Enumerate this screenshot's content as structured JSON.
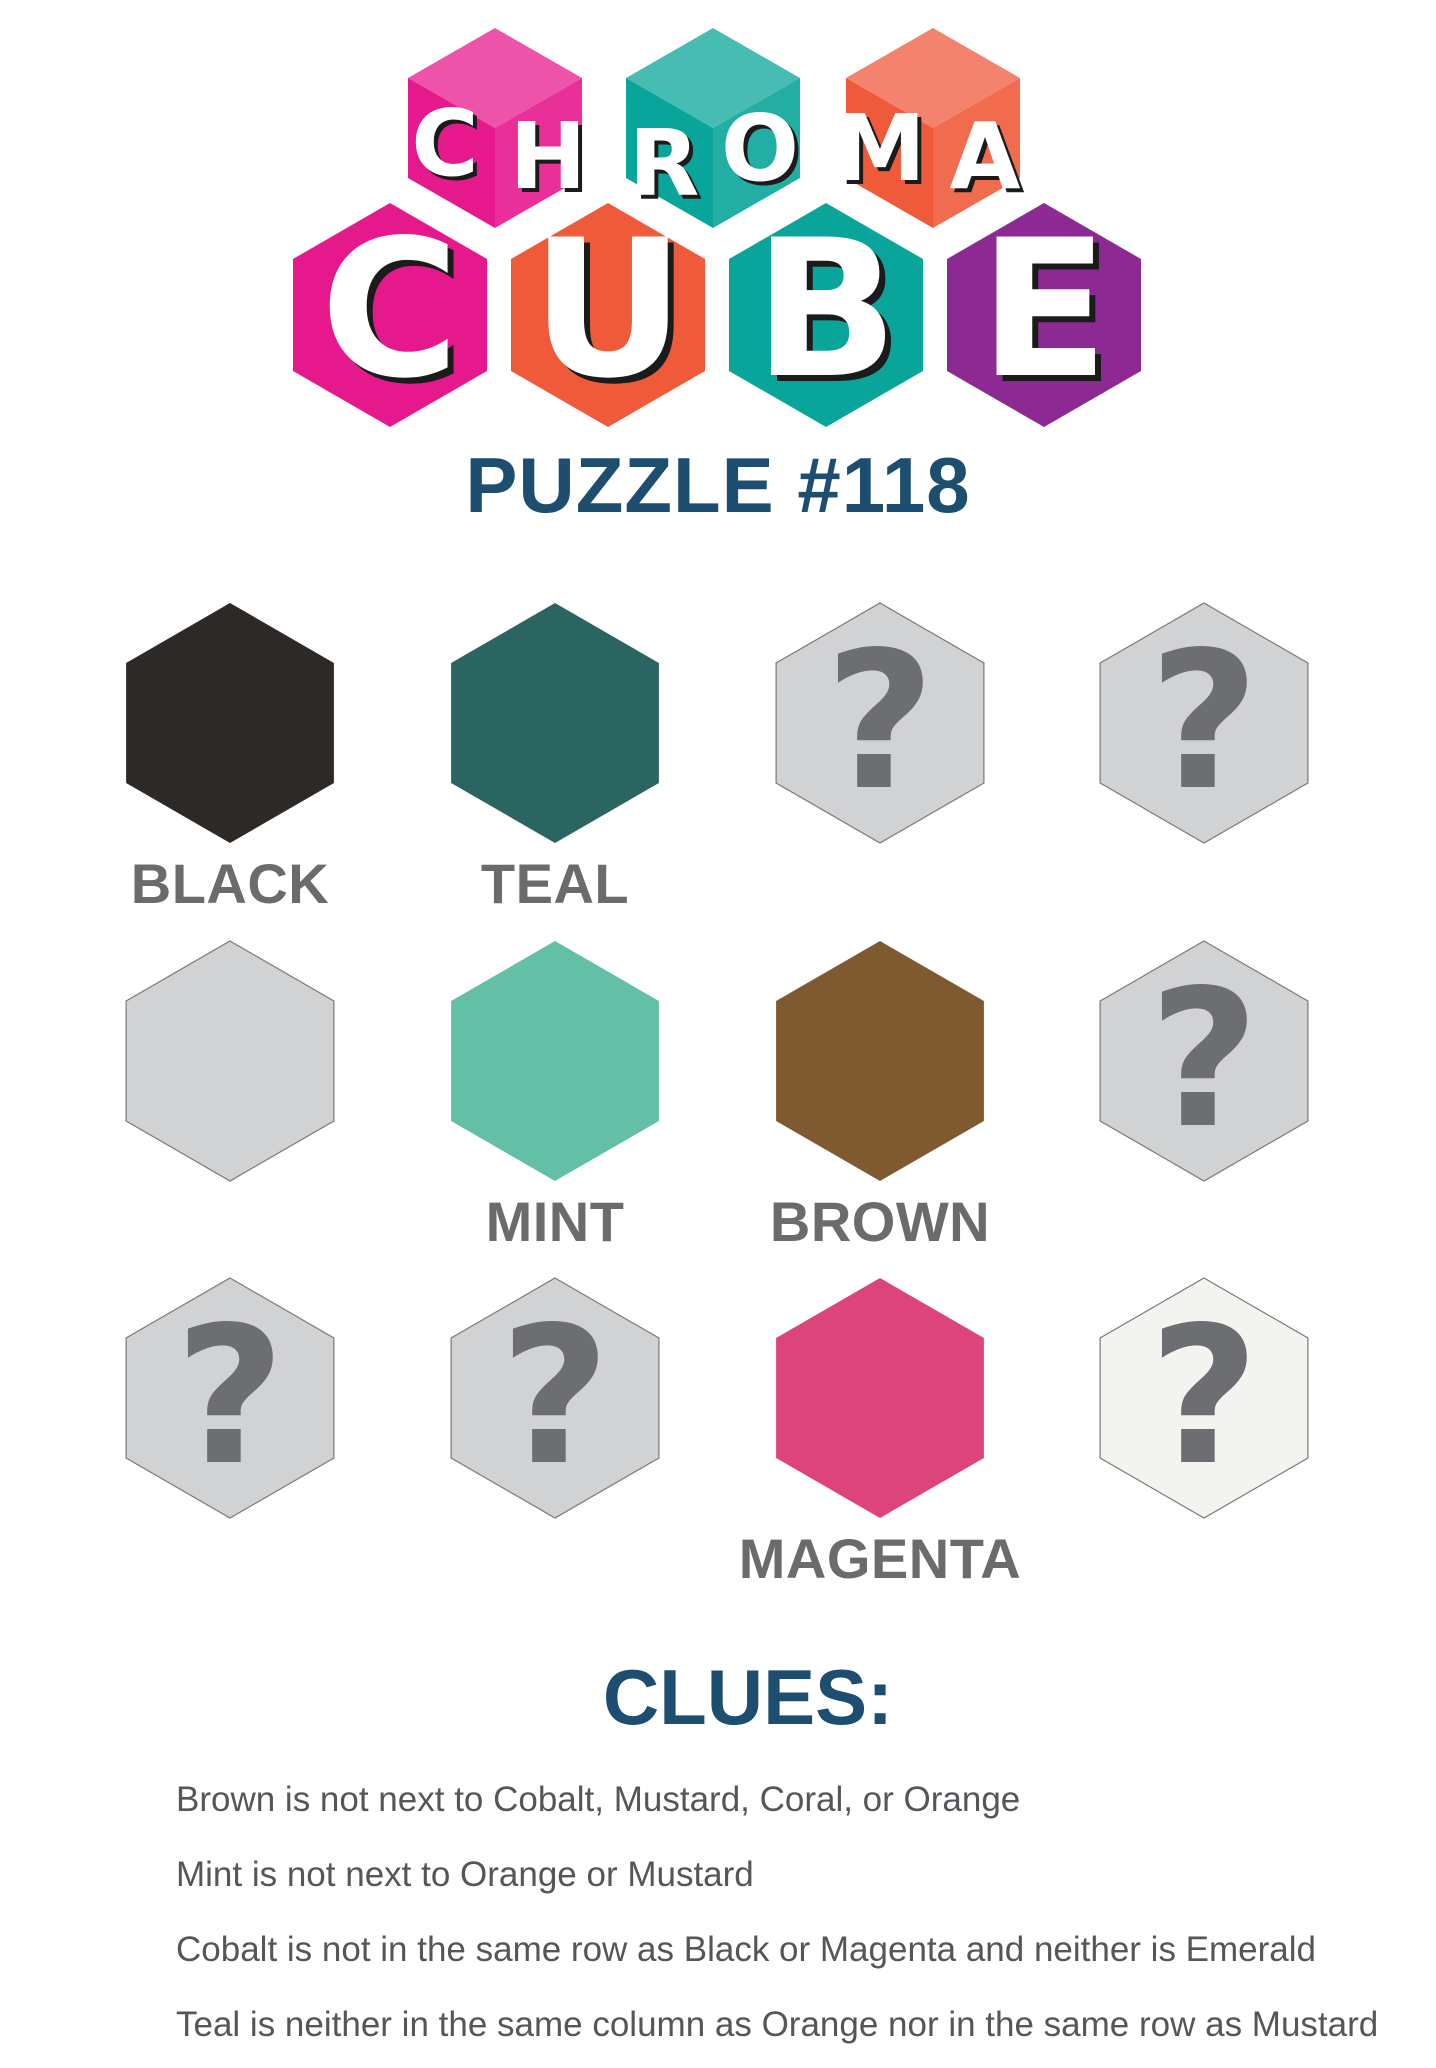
{
  "logo": {
    "top_letters": [
      "C",
      "H",
      "R",
      "O",
      "M",
      "A"
    ],
    "bottom_letters": [
      "C",
      "U",
      "B",
      "E"
    ],
    "colors": {
      "pink": "#e5198c",
      "teal": "#0aa59a",
      "orange": "#ef5a3b",
      "purple": "#8c2992"
    }
  },
  "puzzle_title": "PUZZLE #118",
  "grid": {
    "rows": 3,
    "cols": 4,
    "cells": [
      {
        "color": "#2c2927",
        "label": "BLACK",
        "unknown": false
      },
      {
        "color": "#2b6561",
        "label": "TEAL",
        "unknown": false
      },
      {
        "color": "#d1d2d4",
        "label": "",
        "unknown": true
      },
      {
        "color": "#d1d2d4",
        "label": "",
        "unknown": true
      },
      {
        "color": "#d1d2d4",
        "label": "",
        "unknown": false
      },
      {
        "color": "#63bfa6",
        "label": "MINT",
        "unknown": false
      },
      {
        "color": "#7f5a30",
        "label": "BROWN",
        "unknown": false
      },
      {
        "color": "#d1d2d4",
        "label": "",
        "unknown": true
      },
      {
        "color": "#d1d2d4",
        "label": "",
        "unknown": true
      },
      {
        "color": "#d1d2d4",
        "label": "",
        "unknown": true
      },
      {
        "color": "#dc447b",
        "label": "MAGENTA",
        "unknown": false
      },
      {
        "color": "#f3f4f0",
        "label": "",
        "unknown": true
      }
    ],
    "question_mark": "?",
    "question_color": "#6d6e71"
  },
  "clues_heading": "CLUES:",
  "clues": [
    "Brown is not next to Cobalt, Mustard, Coral, or Orange",
    "Mint is not next to Orange or Mustard",
    "Cobalt is not in the same row as Black or Magenta and neither is Emerald",
    "Teal is neither in the same column as Orange nor in the same row as Mustard"
  ]
}
